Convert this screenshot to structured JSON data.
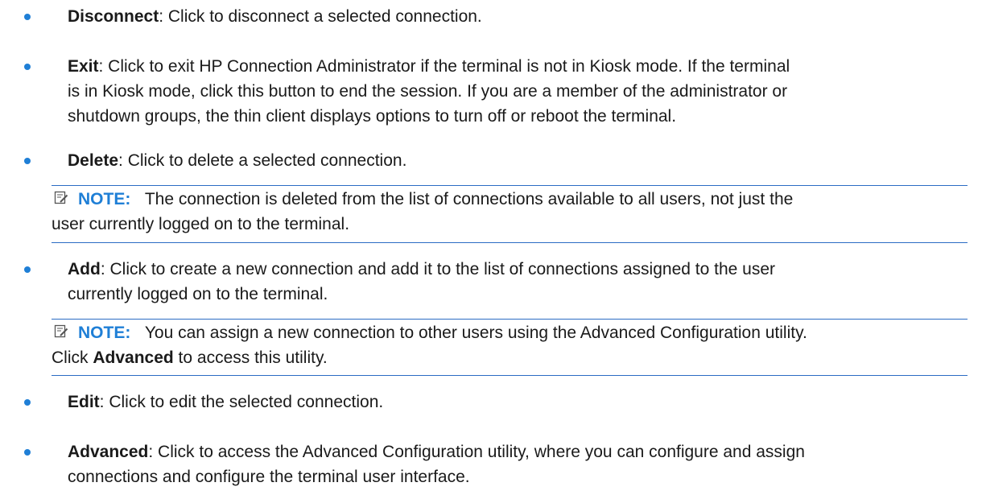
{
  "items": [
    {
      "term": "Disconnect",
      "text": ": Click to disconnect a selected connection."
    },
    {
      "term": "Exit",
      "text_lines": [
        ": Click to exit HP Connection Administrator if the terminal is not in Kiosk mode. If the terminal",
        "is in Kiosk mode, click this button to end the session. If you are a member of the administrator or",
        "shutdown groups, the thin client displays options to turn off or reboot the terminal."
      ]
    },
    {
      "term": "Delete",
      "text": ": Click to delete a selected connection."
    },
    {
      "term": "Add",
      "text_lines": [
        ": Click to create a new connection and add it to the list of connections assigned to the user",
        "currently logged on to the terminal."
      ]
    },
    {
      "term": "Edit",
      "text": ": Click to edit the selected connection."
    },
    {
      "term": "Advanced",
      "text_lines": [
        ": Click to access the Advanced Configuration utility, where you can configure and assign",
        "connections and configure the terminal user interface."
      ]
    }
  ],
  "notes": [
    {
      "label": "NOTE:",
      "lines": [
        "The connection is deleted from the list of connections available to all users, not just the",
        "user currently logged on to the terminal."
      ]
    },
    {
      "label": "NOTE:",
      "lines": [
        "You can assign a new connection to other users using the Advanced Configuration utility.",
        "Click "
      ],
      "bold": "Advanced",
      "after_bold": " to access this utility."
    }
  ],
  "colors": {
    "accent": "#1f7fd6",
    "rule": "#2b6cc4",
    "text": "#1a1a1a"
  },
  "icon": "note-pencil-icon"
}
